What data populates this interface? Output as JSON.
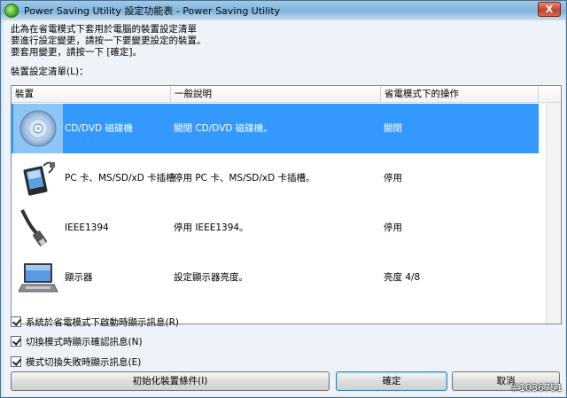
{
  "window": {
    "title": "Power Saving Utility 設定功能表 - Power Saving Utility",
    "close_label": "X"
  },
  "description": {
    "line1": "此為在省電模式下套用於電腦的裝置設定清單",
    "line2": "要進行設定變更，請按一下要變更設定的裝置。",
    "line3": "要套用變更，請按一下 [確定]。"
  },
  "list_label": "裝置設定清單(L)：",
  "list": {
    "columns": [
      "裝置",
      "一般說明",
      "省電模式下的操作"
    ],
    "rows": [
      {
        "icon": "cd-dvd-icon",
        "device": "CD/DVD 磁碟機",
        "description": "關閉 CD/DVD 磁碟機。",
        "action": "關閉",
        "selected": true
      },
      {
        "icon": "pc-card-icon",
        "device": "PC 卡、MS/SD/xD 卡插槽",
        "description": "停用 PC 卡、MS/SD/xD 卡插槽。",
        "action": "停用",
        "selected": false
      },
      {
        "icon": "ieee1394-cable-icon",
        "device": "IEEE1394",
        "description": "停用 IEEE1394。",
        "action": "停用",
        "selected": false
      },
      {
        "icon": "laptop-display-icon",
        "device": "顯示器",
        "description": "設定顯示器亮度。",
        "action": "亮度 4/8",
        "selected": false
      }
    ]
  },
  "checkboxes": [
    {
      "label": "系統於省電模式下啟動時顯示訊息(R)",
      "checked": true
    },
    {
      "label": "切換模式時顯示確認訊息(N)",
      "checked": true
    },
    {
      "label": "模式切換失敗時顯示訊息(E)",
      "checked": true
    }
  ],
  "buttons": {
    "init": "初始化裝置條件(I)",
    "ok": "確定",
    "cancel": "取消"
  },
  "watermark": "#1036751"
}
